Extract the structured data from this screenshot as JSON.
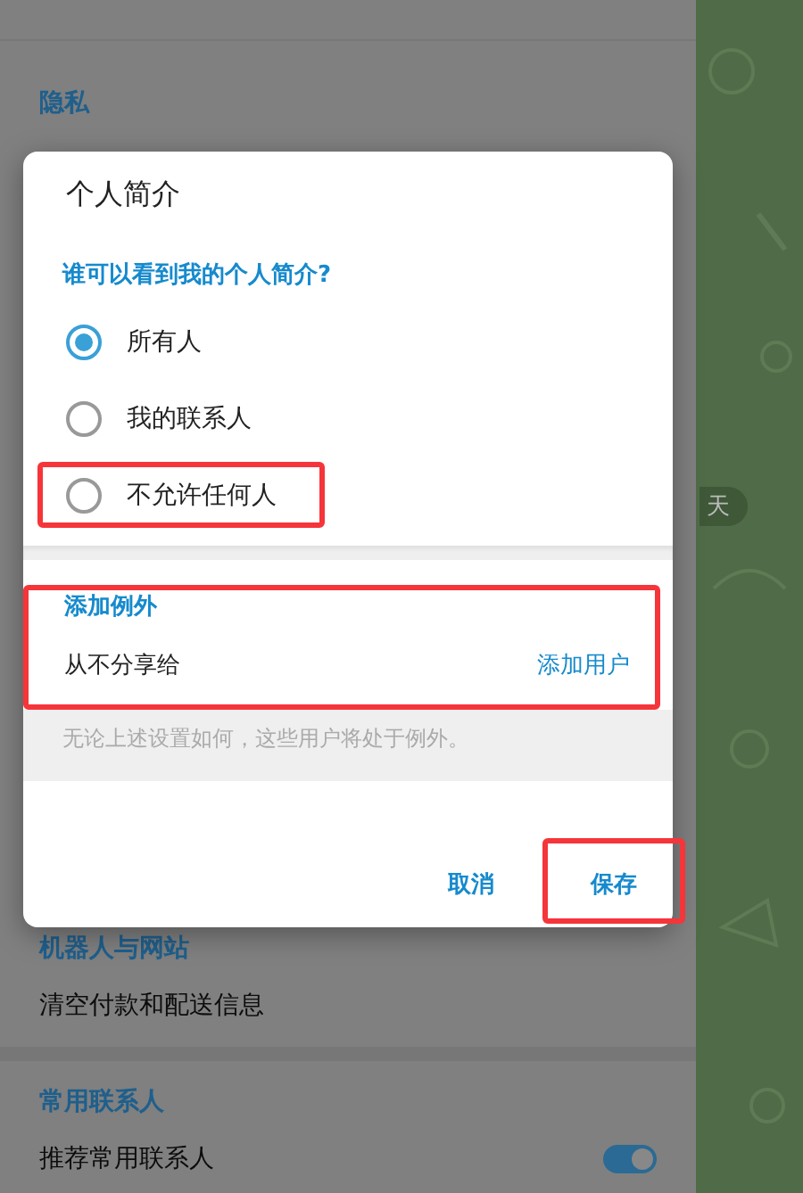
{
  "settings": {
    "sections": [
      {
        "title": "隐私"
      },
      {
        "title": "机器人与网站",
        "rows": [
          {
            "kind": "plain",
            "label": "清空付款和配送信息"
          }
        ]
      },
      {
        "title": "常用联系人",
        "rows": [
          {
            "kind": "toggle",
            "label": "推荐常用联系人",
            "on": true
          }
        ]
      }
    ]
  },
  "chat": {
    "chip": "天"
  },
  "dialog": {
    "title": "个人简介",
    "question": "谁可以看到我的个人简介?",
    "options": [
      {
        "label": "所有人",
        "selected": true,
        "highlighted": false
      },
      {
        "label": "我的联系人",
        "selected": false,
        "highlighted": false
      },
      {
        "label": "不允许任何人",
        "selected": false,
        "highlighted": true
      }
    ],
    "exceptions": {
      "title": "添加例外",
      "label": "从不分享给",
      "action": "添加用户",
      "hint": "无论上述设置如何，这些用户将处于例外。",
      "highlighted": true
    },
    "buttons": [
      {
        "label": "取消",
        "highlighted": false
      },
      {
        "label": "保存",
        "highlighted": true
      }
    ]
  }
}
